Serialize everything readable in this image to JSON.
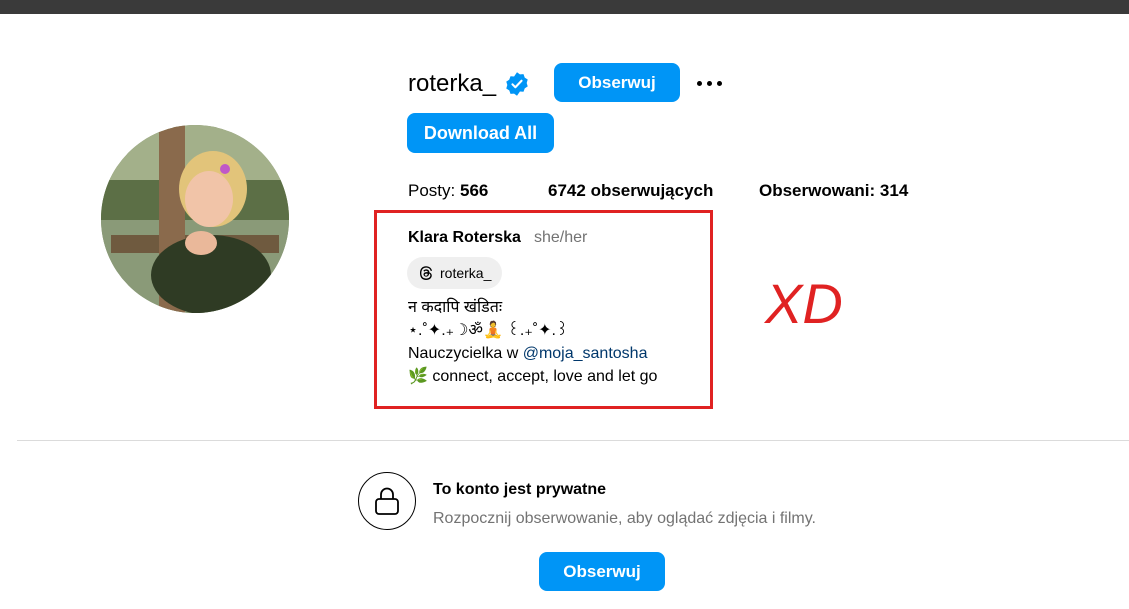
{
  "profile": {
    "username": "roterka_",
    "follow_label": "Obserwuj",
    "download_label": "Download All",
    "stats": {
      "posts_label": "Posty:",
      "posts_value": "566",
      "followers_value": "6742",
      "followers_label": "obserwujących",
      "following_label": "Obserwowani:",
      "following_value": "314"
    },
    "full_name": "Klara Roterska",
    "pronouns": "she/her",
    "threads_handle": "roterka_",
    "bio": {
      "line1": "न कदापि खंडितः",
      "line2": "⋆.˚✦.₊☽ॐ🧘 ꒰.₊˚✦.꒱",
      "line3_prefix": "Nauczycielka w ",
      "line3_mention": "@moja_santosha",
      "line4": "🌿 connect, accept, love and let go"
    }
  },
  "annotation": {
    "text": "XD",
    "color": "#e02222"
  },
  "private_notice": {
    "title": "To konto jest prywatne",
    "subtitle": "Rozpocznij obserwowanie, aby oglądać zdjęcia i filmy.",
    "follow_label": "Obserwuj"
  },
  "icons": {
    "verified": "verified-badge-icon",
    "more": "more-options-icon",
    "threads": "threads-icon",
    "lock": "lock-icon"
  },
  "colors": {
    "accent": "#0095f6",
    "highlight": "#e02222",
    "muted": "#737373",
    "mention": "#00376b"
  }
}
